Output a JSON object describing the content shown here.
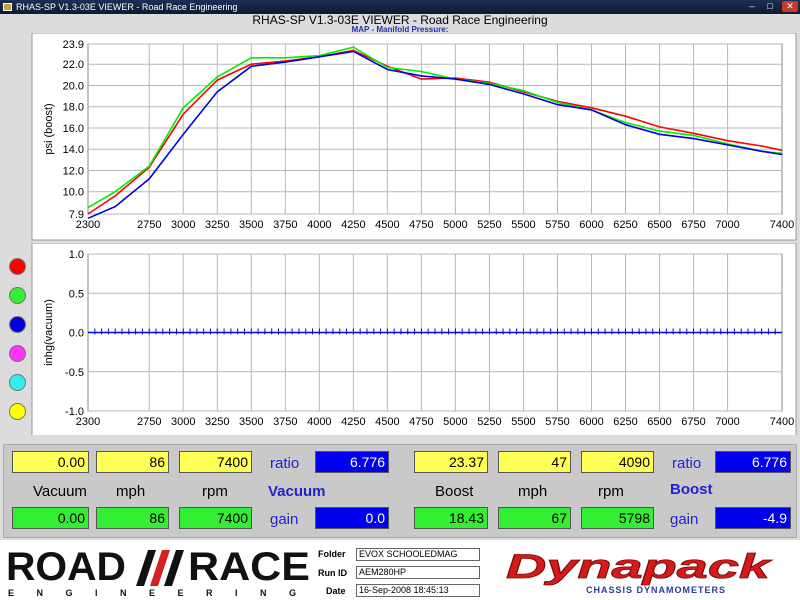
{
  "window": {
    "title": "RHAS-SP V1.3-03E VIEWER - Road Race Engineering"
  },
  "heading": "RHAS-SP V1.3-03E VIEWER - Road Race Engineering",
  "chart_subtitle": "MAP - Manifold Pressure:",
  "chart_data": [
    {
      "type": "line",
      "title": "MAP - Manifold Pressure:",
      "ylabel": "psi (boost)",
      "xlabel": "",
      "xlim": [
        2300,
        7400
      ],
      "ylim": [
        7.9,
        23.9
      ],
      "x_ticks": [
        "2300",
        "2750",
        "3000",
        "3250",
        "3500",
        "3750",
        "4000",
        "4250",
        "4500",
        "4750",
        "5000",
        "5250",
        "5500",
        "5750",
        "6000",
        "6250",
        "6500",
        "6750",
        "7000",
        "7400"
      ],
      "y_ticks": [
        "7.9",
        "10.0",
        "12.0",
        "14.0",
        "16.0",
        "18.0",
        "20.0",
        "22.0",
        "23.9"
      ],
      "grid": true,
      "series": [
        {
          "color": "#ff0000",
          "x": [
            2300,
            2500,
            2750,
            3000,
            3250,
            3500,
            3750,
            4000,
            4250,
            4500,
            4750,
            5000,
            5250,
            5500,
            5750,
            6000,
            6250,
            6500,
            6750,
            7000,
            7250,
            7400
          ],
          "values": [
            7.9,
            9.6,
            12.3,
            17.3,
            20.5,
            22.0,
            22.3,
            22.7,
            23.3,
            21.8,
            20.6,
            20.7,
            20.3,
            19.4,
            18.5,
            17.9,
            17.1,
            16.1,
            15.5,
            14.8,
            14.3,
            13.9
          ]
        },
        {
          "color": "#00ee00",
          "x": [
            2300,
            2500,
            2750,
            3000,
            3250,
            3500,
            3750,
            4000,
            4250,
            4500,
            4750,
            5000,
            5250,
            5500,
            5750,
            6000,
            6250,
            6500,
            6750,
            7000,
            7250,
            7400
          ],
          "values": [
            8.5,
            10.0,
            12.4,
            17.9,
            20.8,
            22.6,
            22.6,
            22.8,
            23.6,
            21.7,
            21.3,
            20.6,
            20.2,
            19.5,
            18.4,
            17.7,
            16.5,
            15.7,
            15.3,
            14.5,
            13.8,
            13.6
          ]
        },
        {
          "color": "#0000dd",
          "x": [
            2300,
            2500,
            2750,
            3000,
            3250,
            3500,
            3750,
            4000,
            4250,
            4500,
            4750,
            5000,
            5250,
            5500,
            5750,
            6000,
            6250,
            6500,
            6750,
            7000,
            7250,
            7400
          ],
          "values": [
            7.5,
            8.6,
            11.2,
            15.4,
            19.4,
            21.8,
            22.2,
            22.7,
            23.2,
            21.5,
            20.9,
            20.6,
            20.1,
            19.2,
            18.2,
            17.7,
            16.3,
            15.4,
            15.0,
            14.4,
            13.8,
            13.5
          ]
        }
      ]
    },
    {
      "type": "line",
      "title": "",
      "ylabel": "inhg(vacuum)",
      "xlabel": "",
      "xlim": [
        2300,
        7400
      ],
      "ylim": [
        -1.0,
        1.0
      ],
      "x_ticks": [
        "2300",
        "2750",
        "3000",
        "3250",
        "3500",
        "3750",
        "4000",
        "4250",
        "4500",
        "4750",
        "5000",
        "5250",
        "5500",
        "5750",
        "6000",
        "6250",
        "6500",
        "6750",
        "7000",
        "7400"
      ],
      "y_ticks": [
        "1.0",
        "0.5",
        "0.0",
        "-0.5",
        "-1.0"
      ],
      "grid": true,
      "series": [
        {
          "color": "#0000dd",
          "x": [
            2300,
            7400
          ],
          "values": [
            0.0,
            0.0
          ]
        }
      ]
    }
  ],
  "legend_colors": [
    "#ff0000",
    "#33ee33",
    "#0000dd",
    "#ff33ff",
    "#33eeee",
    "#ffff00"
  ],
  "vacuum": {
    "top": {
      "vacuum": "0.00",
      "mph": "86",
      "rpm": "7400",
      "ratio_label": "ratio",
      "ratio": "6.776"
    },
    "labels": {
      "vacuum": "Vacuum",
      "mph": "mph",
      "rpm": "rpm",
      "heading": "Vacuum"
    },
    "bottom": {
      "vacuum": "0.00",
      "mph": "86",
      "rpm": "7400",
      "gain_label": "gain",
      "gain": "0.0"
    }
  },
  "boost": {
    "top": {
      "boost": "23.37",
      "mph": "47",
      "rpm": "4090",
      "ratio_label": "ratio",
      "ratio": "6.776"
    },
    "labels": {
      "boost": "Boost",
      "mph": "mph",
      "rpm": "rpm",
      "heading": "Boost"
    },
    "bottom": {
      "boost": "18.43",
      "mph": "67",
      "rpm": "5798",
      "gain_label": "gain",
      "gain": "-4.9"
    }
  },
  "footer": {
    "logo_left": {
      "line1_a": "ROAD",
      "line1_b": "RACE",
      "line2": "ENGINEERING"
    },
    "folder_label": "Folder",
    "folder": "EVOX SCHOOLEDMAG",
    "runid_label": "Run ID",
    "runid": "AEM280HP",
    "date_label": "Date",
    "date": "16-Sep-2008   18:45:13",
    "logo_right": {
      "brand": "Dynapack",
      "tagline": "CHASSIS DYNAMOMETERS"
    }
  }
}
